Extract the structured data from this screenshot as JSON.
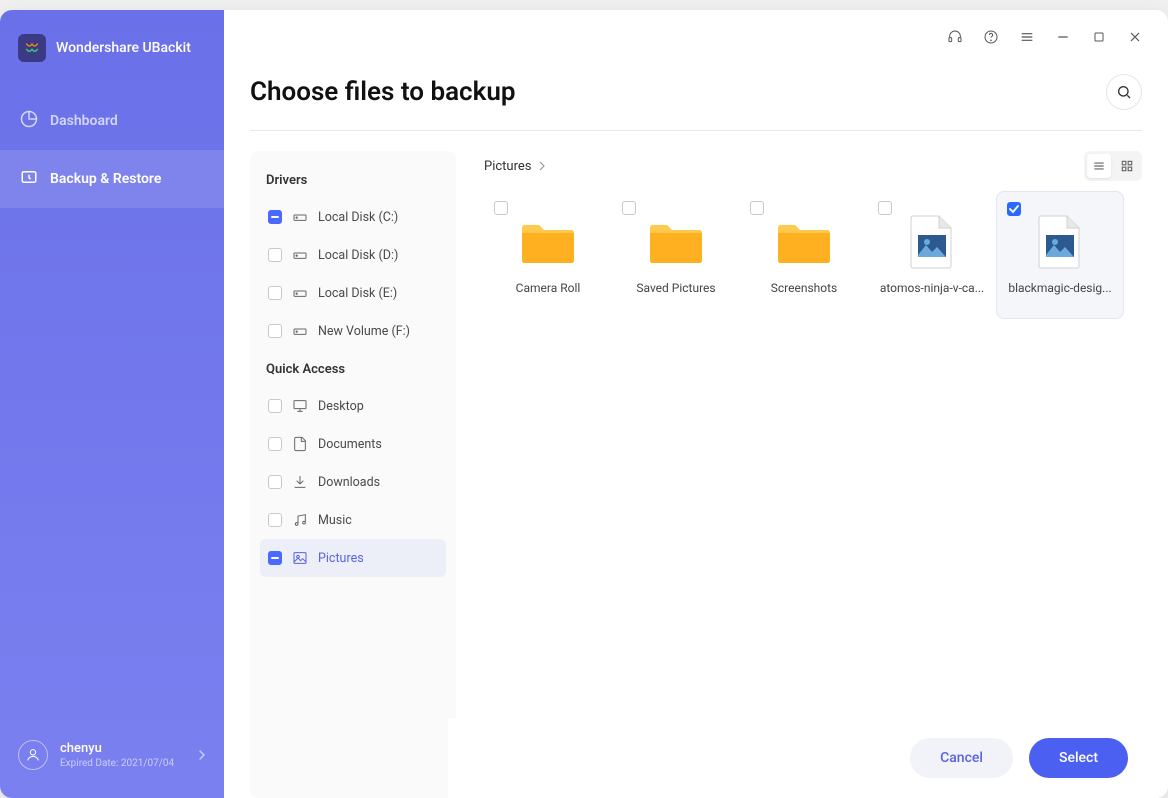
{
  "app": {
    "title": "Wondershare UBackit"
  },
  "nav": {
    "dashboard": "Dashboard",
    "backup_restore": "Backup & Restore"
  },
  "user": {
    "name": "chenyu",
    "expired_label": "Expired Date: 2021/07/04"
  },
  "page": {
    "title": "Choose files to backup",
    "breadcrumb": "Pictures",
    "cancel_label": "Cancel",
    "select_label": "Select"
  },
  "tree": {
    "drivers_heading": "Drivers",
    "drivers": [
      {
        "label": "Local Disk (C:)",
        "state": "indeterminate"
      },
      {
        "label": "Local Disk (D:)",
        "state": "unchecked"
      },
      {
        "label": "Local Disk (E:)",
        "state": "unchecked"
      },
      {
        "label": "New Volume (F:)",
        "state": "unchecked"
      }
    ],
    "quick_heading": "Quick Access",
    "quick": [
      {
        "label": "Desktop",
        "state": "unchecked",
        "active": false,
        "icon": "monitor"
      },
      {
        "label": "Documents",
        "state": "unchecked",
        "active": false,
        "icon": "document"
      },
      {
        "label": "Downloads",
        "state": "unchecked",
        "active": false,
        "icon": "download"
      },
      {
        "label": "Music",
        "state": "unchecked",
        "active": false,
        "icon": "music"
      },
      {
        "label": "Pictures",
        "state": "indeterminate",
        "active": true,
        "icon": "picture"
      }
    ]
  },
  "files": [
    {
      "name": "Camera Roll",
      "type": "folder",
      "checked": false
    },
    {
      "name": "Saved Pictures",
      "type": "folder",
      "checked": false
    },
    {
      "name": "Screenshots",
      "type": "folder",
      "checked": false
    },
    {
      "name": "atomos-ninja-v-ca...",
      "type": "image",
      "checked": false
    },
    {
      "name": "blackmagic-desig...",
      "type": "image",
      "checked": true
    }
  ]
}
